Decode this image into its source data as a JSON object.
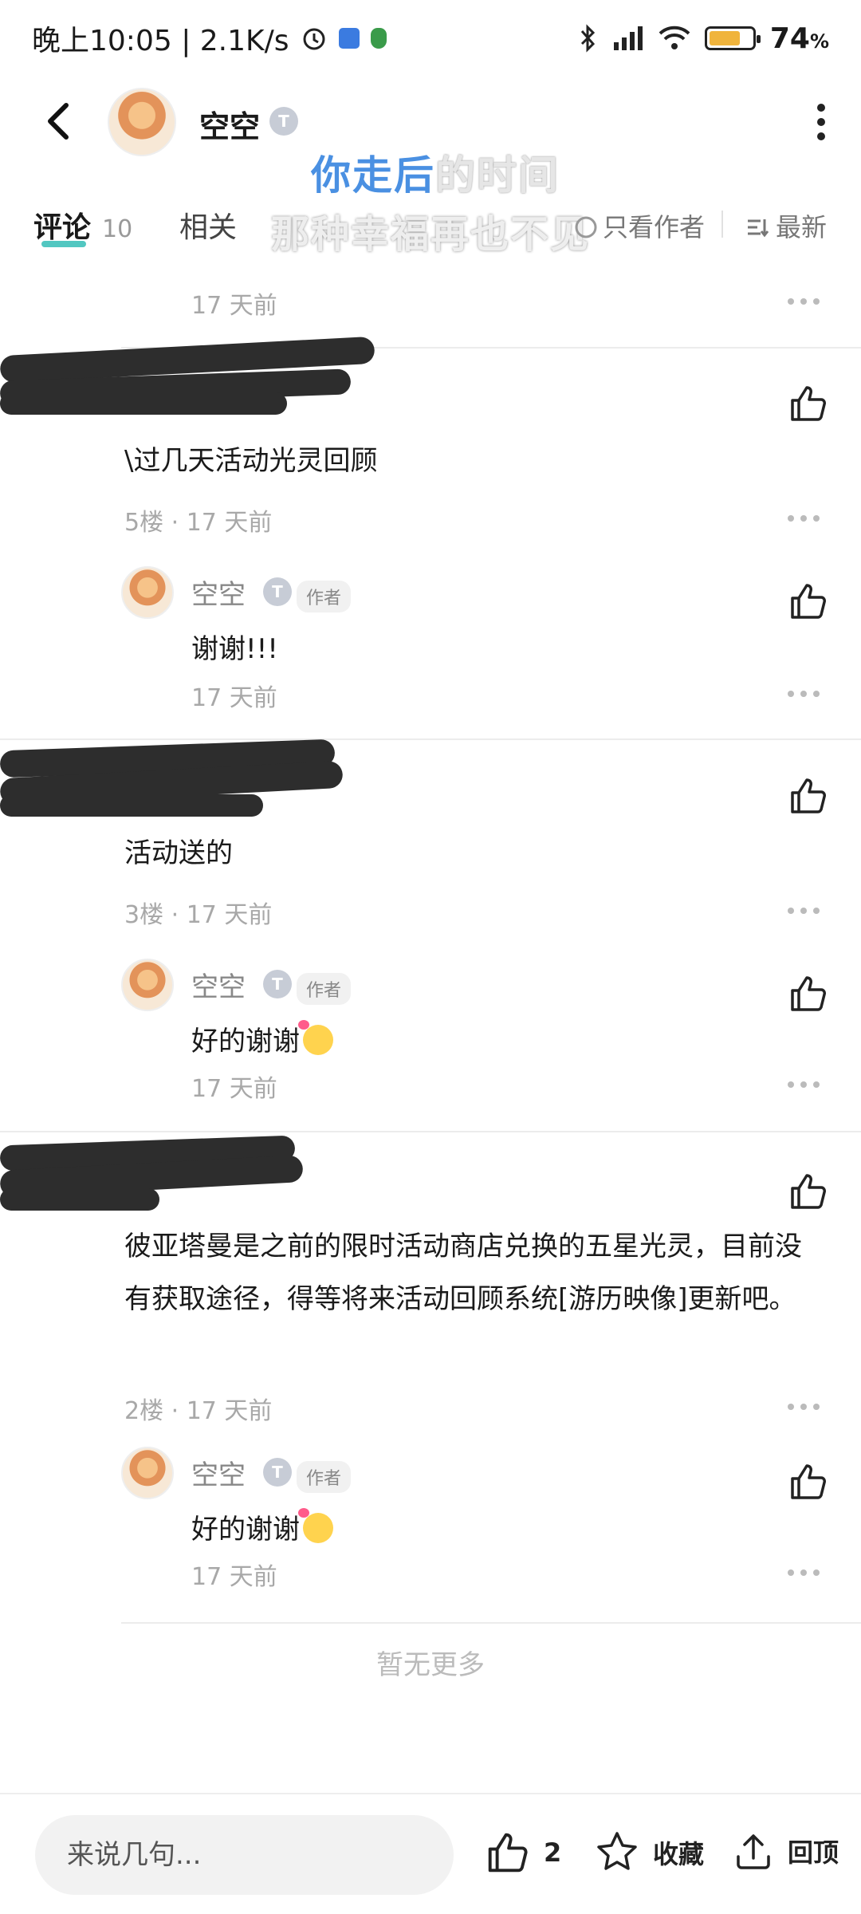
{
  "status_bar": {
    "time_speed": "晚上10:05 | 2.1K/s",
    "battery": "74",
    "battery_unit": "%",
    "battery_level": 0.74
  },
  "header": {
    "user_name": "空空",
    "badge": "T",
    "icons": {
      "back": "back-arrow-icon",
      "more": "more-vertical-icon"
    }
  },
  "overlay_lyrics": {
    "line1_highlight": "你走后",
    "line1_rest": "的时间",
    "line2": "那种幸福再也不见"
  },
  "tabs": {
    "comments_label": "评论",
    "comments_count": "10",
    "related_label": "相关",
    "author_only_label": "只看作者",
    "latest_label": "最新"
  },
  "comments": {
    "top_time": "17 天前",
    "c5": {
      "text": "\\过几天活动光灵回顾",
      "floor": "5楼 · 17 天前",
      "reply": {
        "name": "空空",
        "badge": "T",
        "tag": "作者",
        "text": "谢谢!!!",
        "time": "17 天前"
      }
    },
    "c3": {
      "text": "活动送的",
      "floor": "3楼 · 17 天前",
      "reply": {
        "name": "空空",
        "badge": "T",
        "tag": "作者",
        "text": "好的谢谢",
        "time": "17 天前"
      }
    },
    "c2": {
      "text": "彼亚塔曼是之前的限时活动商店兑换的五星光灵，目前没有获取途径，得等将来活动回顾系统[游历映像]更新吧。",
      "floor": "2楼 · 17 天前",
      "reply": {
        "name": "空空",
        "badge": "T",
        "tag": "作者",
        "text": "好的谢谢",
        "time": "17 天前"
      }
    }
  },
  "no_more": "暂无更多",
  "bottom_bar": {
    "input_placeholder": "来说几句...",
    "like_count": "2",
    "favorite_label": "收藏",
    "top_label": "回顶"
  }
}
